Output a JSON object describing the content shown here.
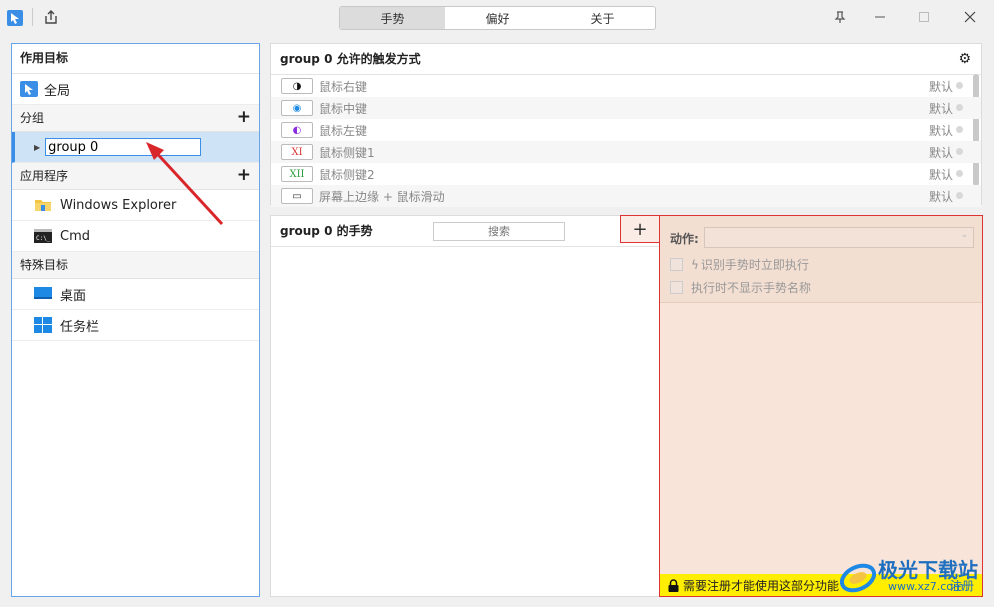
{
  "tabs": [
    {
      "label": "手势",
      "active": true
    },
    {
      "label": "偏好",
      "active": false
    },
    {
      "label": "关于",
      "active": false
    }
  ],
  "left": {
    "header": "作用目标",
    "global_label": "全局",
    "groups_label": "分组",
    "group_input_value": "group 0",
    "apps_label": "应用程序",
    "apps": [
      "Windows Explorer",
      "Cmd"
    ],
    "special_label": "特殊目标",
    "special": [
      "桌面",
      "任务栏"
    ]
  },
  "triggers": {
    "title": "group 0 允许的触发方式",
    "items": [
      {
        "badge": "◑",
        "label": "鼠标右键",
        "default": "默认"
      },
      {
        "badge": "◉",
        "label": "鼠标中键",
        "default": "默认"
      },
      {
        "badge": "◐",
        "label": "鼠标左键",
        "default": "默认"
      },
      {
        "badge": "XI",
        "label": "鼠标侧键1",
        "default": "默认"
      },
      {
        "badge": "XII",
        "label": "鼠标侧键2",
        "default": "默认"
      },
      {
        "badge": "▭",
        "label": "屏幕上边缘 + 鼠标滑动",
        "default": "默认"
      }
    ]
  },
  "gestures": {
    "title": "group 0 的手势",
    "search_placeholder": "搜索",
    "add_label": "+"
  },
  "action": {
    "label": "动作:",
    "opt1": "识别手势时立即执行",
    "opt2": "执行时不显示手势名称",
    "register_notice": "需要注册才能使用这部分功能",
    "register_button": "注册"
  },
  "watermark": {
    "text": "极光下载站",
    "url_text": "www.xz7.com"
  },
  "colors": {
    "accent": "#1e88e5",
    "register_bar": "#ffee00",
    "highlight_border": "#dd3333"
  }
}
